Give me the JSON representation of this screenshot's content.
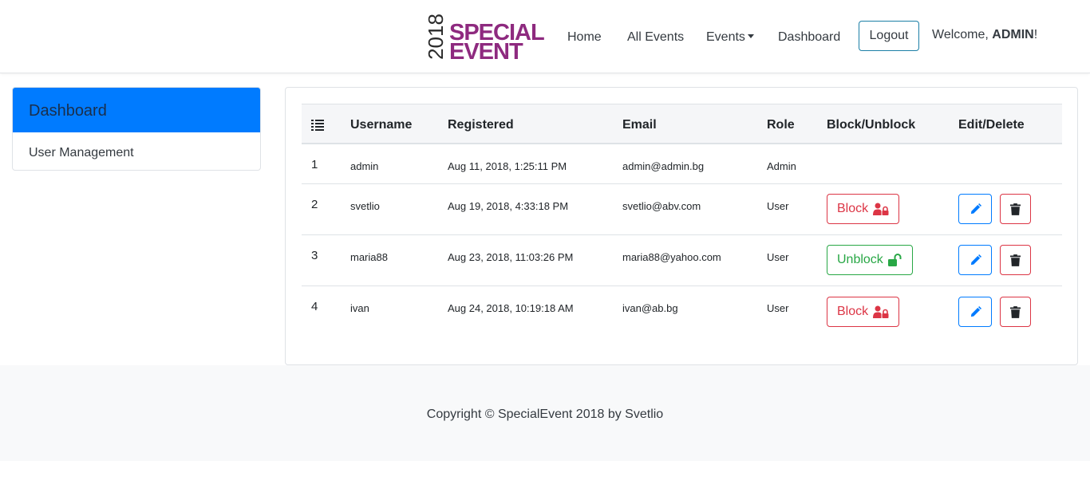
{
  "nav": {
    "logo_year": "2018",
    "logo_word1": "SPECIAL",
    "logo_word2": "EVENT",
    "home": "Home",
    "all_events": "All Events",
    "events": "Events",
    "dashboard": "Dashboard",
    "logout": "Logout",
    "welcome_prefix": "Welcome, ",
    "welcome_user": "ADMIN",
    "welcome_suffix": "!"
  },
  "sidebar": {
    "items": [
      {
        "label": "Dashboard",
        "active": true
      },
      {
        "label": "User Management",
        "active": false
      }
    ]
  },
  "table": {
    "columns": [
      "Username",
      "Registered",
      "Email",
      "Role",
      "Block/Unblock",
      "Edit/Delete"
    ],
    "rows": [
      {
        "index": "1",
        "username": "admin",
        "registered": "Aug 11, 2018, 1:25:11 PM",
        "email": "admin@admin.bg",
        "role": "Admin",
        "action": ""
      },
      {
        "index": "2",
        "username": "svetlio",
        "registered": "Aug 19, 2018, 4:33:18 PM",
        "email": "svetlio@abv.com",
        "role": "User",
        "action": "Block"
      },
      {
        "index": "3",
        "username": "maria88",
        "registered": "Aug 23, 2018, 11:03:26 PM",
        "email": "maria88@yahoo.com",
        "role": "User",
        "action": "Unblock"
      },
      {
        "index": "4",
        "username": "ivan",
        "registered": "Aug 24, 2018, 10:19:18 AM",
        "email": "ivan@ab.bg",
        "role": "User",
        "action": "Block"
      }
    ]
  },
  "footer": {
    "copyright": "Copyright © SpecialEvent 2018 by Svetlio"
  },
  "colors": {
    "brand": "#8e2a7f",
    "primary": "#007bff",
    "danger": "#dc3545",
    "success": "#28a745"
  },
  "icons": {
    "list": "list-icon",
    "block": "user-lock-icon",
    "unblock": "unlock-icon",
    "edit": "pencil-icon",
    "delete": "trash-icon"
  }
}
